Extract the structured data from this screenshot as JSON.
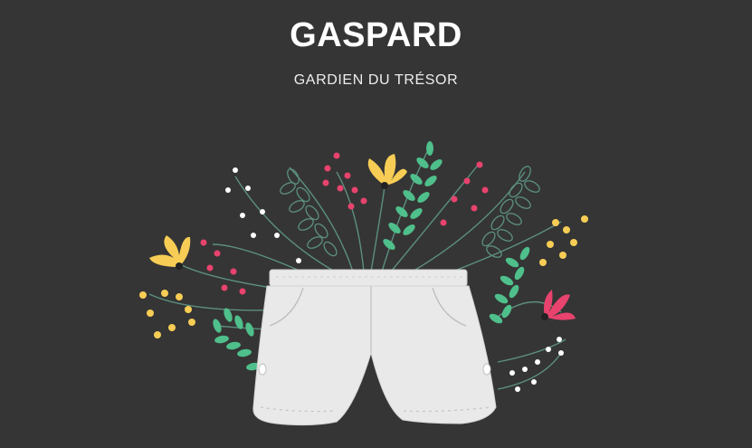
{
  "header": {
    "title": "GASPARD",
    "subtitle": "GARDIEN DU TRÉSOR"
  },
  "illustration": {
    "subject": "shorts-with-flowers",
    "colors": {
      "background": "#353535",
      "shorts": "#e9e9e9",
      "shorts_shadow": "#c9c9c9",
      "stem": "#5c8f80",
      "leaf": "#4fbf8b",
      "yellow": "#f7cd55",
      "pink": "#e8436e",
      "white": "#ffffff"
    }
  }
}
